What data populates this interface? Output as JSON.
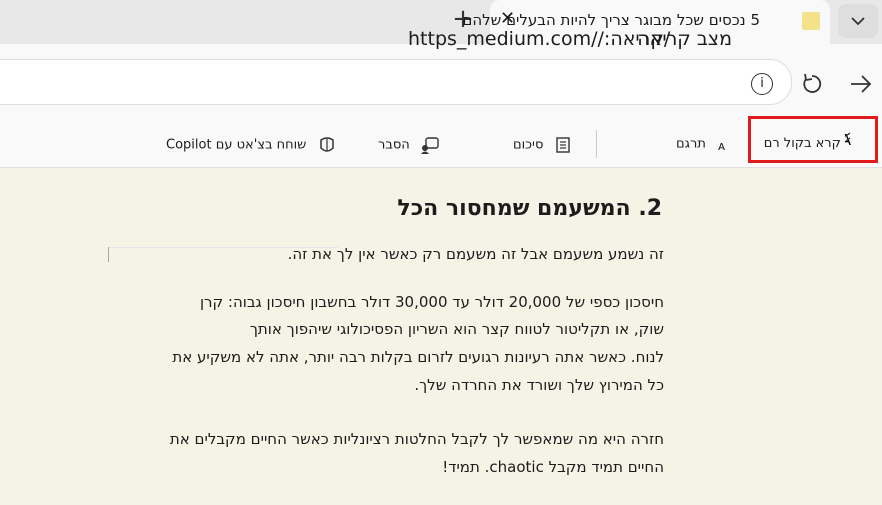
{
  "tab": {
    "title": "5 נכסים שכל מבוגר צריך להיות הבעלים שלהם",
    "close": "✕",
    "new_tab": "+"
  },
  "address": {
    "prefix": "מצב קריאה",
    "url": "https_medium.com//:קריאה/",
    "info": "i"
  },
  "toolbar": {
    "read_aloud": "קרא בקול רם",
    "translate": "תרגם",
    "summary": "סיכום",
    "explain": "הסבר",
    "copilot_chat": "שוחח בצ'אט עם Copilot"
  },
  "article": {
    "heading": "2. המשעמם שמחסור הכל",
    "para1": "זה נשמע משעמם אבל זה משעמם רק כאשר אין לך את זה.",
    "para2_line1": "חיסכון כספי של 20,000 דולר עד 30,000 דולר בחשבון חיסכון גבוה: קרן",
    "para2_line2": "שוק, או תקליטור לטווח קצר הוא השריון הפסיכולוגי שיהפוך אותך",
    "para2_line3": "לנוח. כאשר אתה רעיונות רגועים לזרום בקלות רבה יותר, אתה לא משקיע את",
    "para2_line4": "כל המירוץ שלך ושורד את החרדה שלך.",
    "para3_line1": "חזרה היא מה שמאפשר לך לקבל החלטות רציונליות כאשר החיים מקבלים את",
    "para3_line2": "החיים תמיד מקבל  chaotic. תמיד!"
  }
}
